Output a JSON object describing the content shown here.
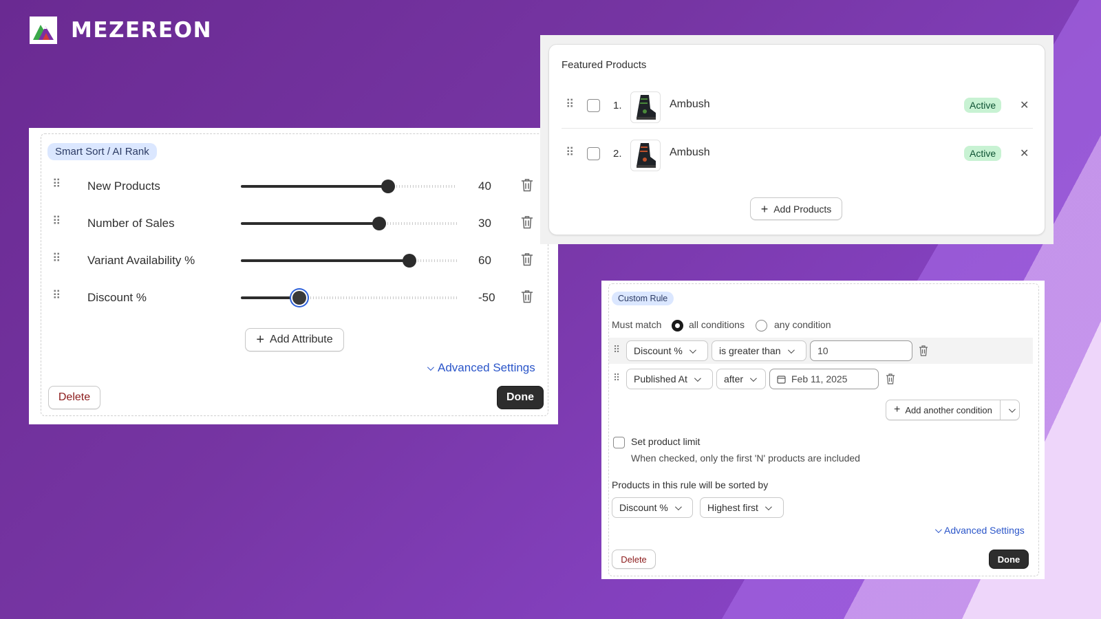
{
  "brand": {
    "name": "MEZEREON",
    "colors": {
      "green": "#3aa84a",
      "purple": "#7b2fa3",
      "red": "#d23a3a"
    }
  },
  "smart_sort": {
    "chip": "Smart Sort / AI Rank",
    "attributes": [
      {
        "label": "New Products",
        "value": "40",
        "fill": 0.68,
        "focused": false
      },
      {
        "label": "Number of Sales",
        "value": "30",
        "fill": 0.64,
        "focused": false
      },
      {
        "label": "Variant Availability %",
        "value": "60",
        "fill": 0.78,
        "focused": false
      },
      {
        "label": "Discount %",
        "value": "-50",
        "fill": 0.27,
        "focused": true
      }
    ],
    "add_attribute": "Add Attribute",
    "advanced_settings": "Advanced Settings",
    "delete": "Delete",
    "done": "Done"
  },
  "featured": {
    "title": "Featured Products",
    "products": [
      {
        "num": "1.",
        "name": "Ambush",
        "status": "Active",
        "shoe_accent": "#4a8a3a"
      },
      {
        "num": "2.",
        "name": "Ambush",
        "status": "Active",
        "shoe_accent": "#c0502a"
      }
    ],
    "add_products": "Add Products"
  },
  "custom_rule": {
    "chip": "Custom Rule",
    "must_match": "Must match",
    "all_conditions": "all conditions",
    "any_condition": "any condition",
    "conditions": [
      {
        "field": "Discount %",
        "operator": "is greater than",
        "value": "10"
      },
      {
        "field": "Published At",
        "operator": "after",
        "value": "Feb 11, 2025"
      }
    ],
    "add_condition": "Add another condition",
    "product_limit_label": "Set product limit",
    "product_limit_help": "When checked, only the first 'N' products are included",
    "sorted_by_label": "Products in this rule will be sorted by",
    "sort_field": "Discount %",
    "sort_order": "Highest first",
    "advanced_settings": "Advanced Settings",
    "delete": "Delete",
    "done": "Done"
  }
}
